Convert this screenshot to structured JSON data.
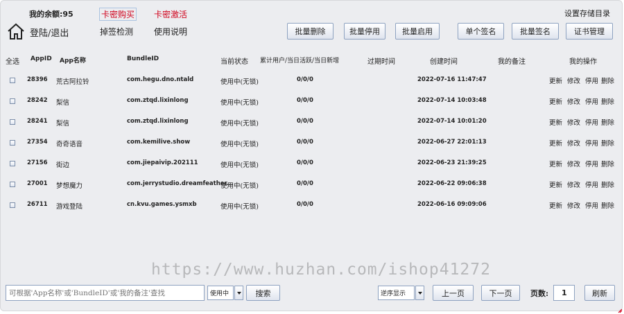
{
  "header": {
    "balance": "我的余额:95",
    "buy_card": "卡密购买",
    "activate_card": "卡密激活",
    "settings": "设置存储目录",
    "login_logout": "登陆/退出",
    "check_signature": "掉签检测",
    "help": "使用说明"
  },
  "toolbar": {
    "batch_delete": "批量删除",
    "batch_disable": "批量停用",
    "batch_enable": "批量启用",
    "single_sign": "单个签名",
    "batch_sign": "批量签名",
    "cert_manage": "证书管理"
  },
  "table": {
    "columns": {
      "select_all": "全选",
      "app_id": "AppID",
      "app_name": "App名称",
      "bundle_id": "BundleID",
      "status": "当前状态",
      "users": "累计用户/当日活跃/当日新增",
      "expire": "过期时间",
      "created": "创建时间",
      "note": "我的备注",
      "actions": "我的操作"
    },
    "action_labels": [
      "更新",
      "修改",
      "停用",
      "删除"
    ],
    "rows": [
      {
        "id": "28396",
        "name": "荒古阿拉铃",
        "bundle": "com.hegu.dno.ntald",
        "status": "使用中(无锁)",
        "users": "0/0/0",
        "expire": "",
        "created": "2022-07-16 11:47:47",
        "note": ""
      },
      {
        "id": "28242",
        "name": "梨信",
        "bundle": "com.ztqd.lixinlong",
        "status": "使用中(无锁)",
        "users": "0/0/0",
        "expire": "",
        "created": "2022-07-14 10:03:48",
        "note": ""
      },
      {
        "id": "28241",
        "name": "梨信",
        "bundle": "com.ztqd.lixinlong",
        "status": "使用中(无锁)",
        "users": "0/0/0",
        "expire": "",
        "created": "2022-07-14 10:01:20",
        "note": ""
      },
      {
        "id": "27354",
        "name": "奇奇语音",
        "bundle": "com.kemilive.show",
        "status": "使用中(无锁)",
        "users": "0/0/0",
        "expire": "",
        "created": "2022-06-27 22:01:13",
        "note": ""
      },
      {
        "id": "27156",
        "name": "街边",
        "bundle": "com.jiepaivip.202111",
        "status": "使用中(无锁)",
        "users": "0/0/0",
        "expire": "",
        "created": "2022-06-23 21:39:25",
        "note": ""
      },
      {
        "id": "27001",
        "name": "梦想魔力",
        "bundle": "com.jerrystudio.dreamfeather...",
        "status": "使用中(无锁)",
        "users": "0/0/0",
        "expire": "",
        "created": "2022-06-22 09:06:38",
        "note": ""
      },
      {
        "id": "26711",
        "name": "游戏登陆",
        "bundle": "cn.kvu.games.ysmxb",
        "status": "使用中(无锁)",
        "users": "0/0/0",
        "expire": "",
        "created": "2022-06-16 09:09:06",
        "note": ""
      }
    ]
  },
  "watermark": "https://www.huzhan.com/ishop41272",
  "footer": {
    "search_placeholder": "可根据'App名称'或'BundleID'或'我的备注'查找",
    "status_filter": "使用中",
    "search": "搜索",
    "order": "逆序显示",
    "prev_page": "上一页",
    "next_page": "下一页",
    "page_label": "页数:",
    "page_value": "1",
    "refresh": "刷新"
  },
  "colors": {
    "accent_red": "#d0021b",
    "button_border": "#8ea2c0",
    "background": "#ecedf0"
  }
}
